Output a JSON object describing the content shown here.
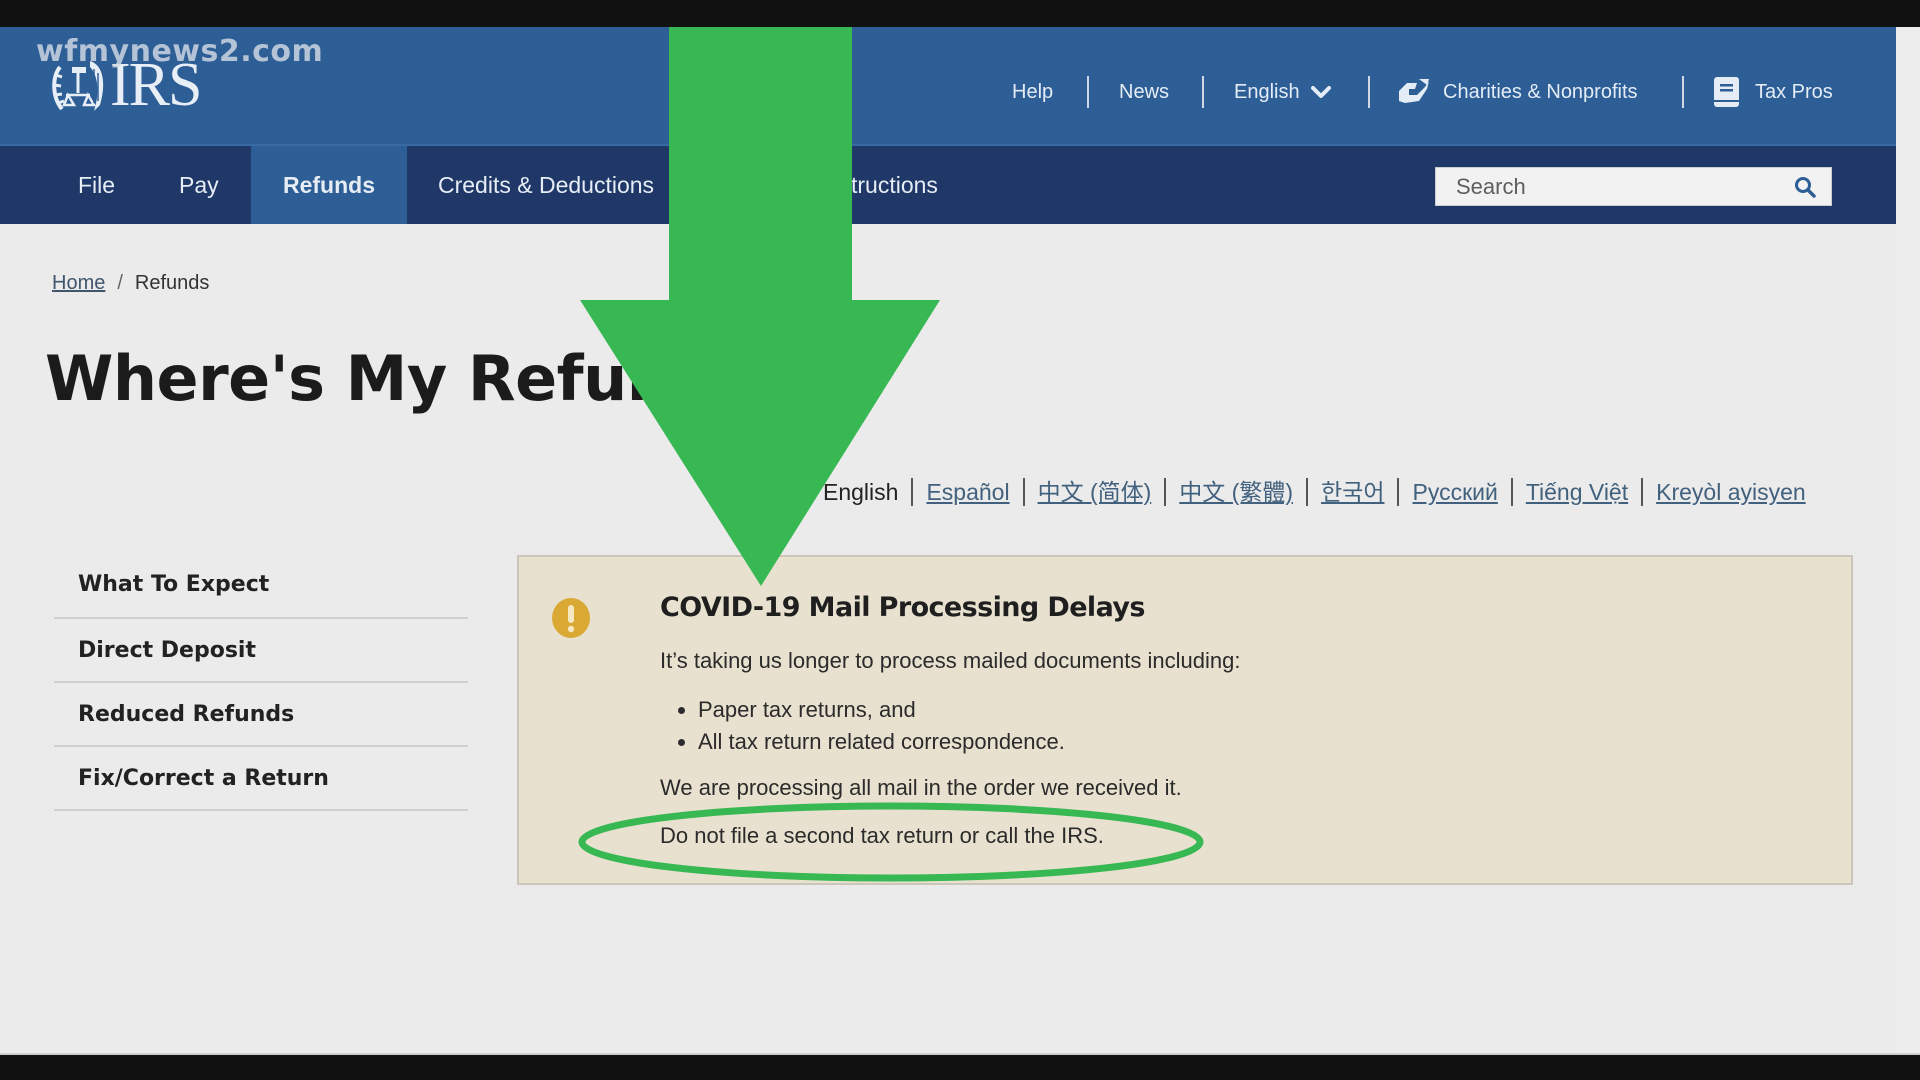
{
  "watermark": "wfmynews2.com",
  "logo": {
    "text": "IRS"
  },
  "utility_nav": {
    "help": "Help",
    "news": "News",
    "language": "English",
    "charities": "Charities & Nonprofits",
    "tax_pros": "Tax Pros"
  },
  "main_nav": {
    "items": [
      {
        "label": "File"
      },
      {
        "label": "Pay"
      },
      {
        "label": "Refunds",
        "active": true
      },
      {
        "label": "Credits & Deductions"
      },
      {
        "label": "tructions"
      }
    ]
  },
  "search": {
    "placeholder": "Search"
  },
  "breadcrumb": {
    "home": "Home",
    "separator": "/",
    "current": "Refunds"
  },
  "page": {
    "title": "Where's My Refund?"
  },
  "languages": [
    {
      "label": "English",
      "current": true
    },
    {
      "label": "Español"
    },
    {
      "label": "中文 (简体)"
    },
    {
      "label": "中文 (繁體)"
    },
    {
      "label": "한국어"
    },
    {
      "label": "Русский"
    },
    {
      "label": "Tiếng Việt"
    },
    {
      "label": "Kreyòl ayisyen"
    }
  ],
  "sidenav": {
    "items": [
      {
        "label": "What To Expect"
      },
      {
        "label": "Direct Deposit"
      },
      {
        "label": "Reduced Refunds"
      },
      {
        "label": "Fix/Correct a Return"
      }
    ]
  },
  "alert": {
    "icon": "exclamation-icon",
    "title": "COVID-19 Mail Processing Delays",
    "intro": "It’s taking us longer to process mailed documents including:",
    "bullets": [
      "Paper tax returns, and",
      "All tax return related correspondence."
    ],
    "line2": "We are processing all mail in the order we received it.",
    "line3": "Do not file a second tax return or call the IRS."
  },
  "annotations": {
    "arrow_color": "#37b853",
    "ellipse_color": "#37b853"
  },
  "colors": {
    "header_blue": "#2d5e96",
    "nav_dark": "#1f3868",
    "alert_bg": "#e8e1cf",
    "alert_icon": "#d9a934"
  }
}
